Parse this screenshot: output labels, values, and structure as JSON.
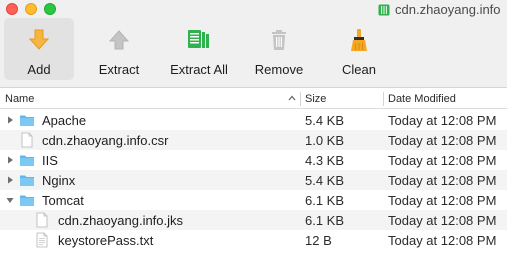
{
  "window": {
    "title": "cdn.zhaoyang.info"
  },
  "toolbar": {
    "buttons": [
      {
        "label": "Add",
        "icon": "arrow-down-icon"
      },
      {
        "label": "Extract",
        "icon": "arrow-up-icon"
      },
      {
        "label": "Extract All",
        "icon": "documents-icon"
      },
      {
        "label": "Remove",
        "icon": "trash-icon"
      },
      {
        "label": "Clean",
        "icon": "broom-icon"
      }
    ]
  },
  "columns": {
    "name": "Name",
    "size": "Size",
    "date": "Date Modified"
  },
  "rows": [
    {
      "name": "Apache",
      "type": "folder",
      "size": "5.4 KB",
      "date": "Today at 12:08 PM",
      "expanded": false
    },
    {
      "name": "cdn.zhaoyang.info.csr",
      "type": "file",
      "size": "1.0 KB",
      "date": "Today at 12:08 PM"
    },
    {
      "name": "IIS",
      "type": "folder",
      "size": "4.3 KB",
      "date": "Today at 12:08 PM",
      "expanded": false
    },
    {
      "name": "Nginx",
      "type": "folder",
      "size": "5.4 KB",
      "date": "Today at 12:08 PM",
      "expanded": false
    },
    {
      "name": "Tomcat",
      "type": "folder",
      "size": "6.1 KB",
      "date": "Today at 12:08 PM",
      "expanded": true
    },
    {
      "name": "cdn.zhaoyang.info.jks",
      "type": "file",
      "size": "6.1 KB",
      "date": "Today at 12:08 PM"
    },
    {
      "name": "keystorePass.txt",
      "type": "file",
      "size": "12 B",
      "date": "Today at 12:08 PM"
    }
  ],
  "colors": {
    "folder": "#5bb8f0",
    "accent_orange": "#f5a623",
    "accent_green": "#2fb24b"
  }
}
